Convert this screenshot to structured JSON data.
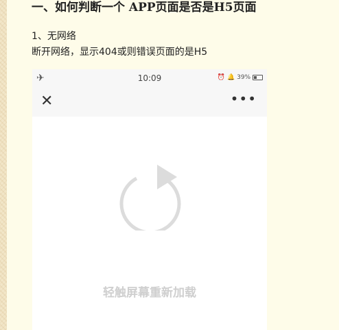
{
  "article": {
    "heading": "一、如何判断一个 APP页面是否是H5页面",
    "line1": "1、无网络",
    "line2": "断开网络，显示404或则错误页面的是H5"
  },
  "phone": {
    "status_bar": {
      "time": "10:09",
      "battery": "39%"
    },
    "nav": {
      "close_glyph": "✕",
      "more_glyph": "•••"
    },
    "content": {
      "retry_text": "轻触屏幕重新加载"
    }
  },
  "colors": {
    "background": "#f2e6c8",
    "paper": "#fefce9",
    "refresh_icon": "#dcdcdc"
  },
  "icons": [
    "airplane-mode-icon",
    "alarm-icon",
    "bell-icon",
    "battery-icon",
    "close-icon",
    "more-icon",
    "refresh-icon"
  ]
}
